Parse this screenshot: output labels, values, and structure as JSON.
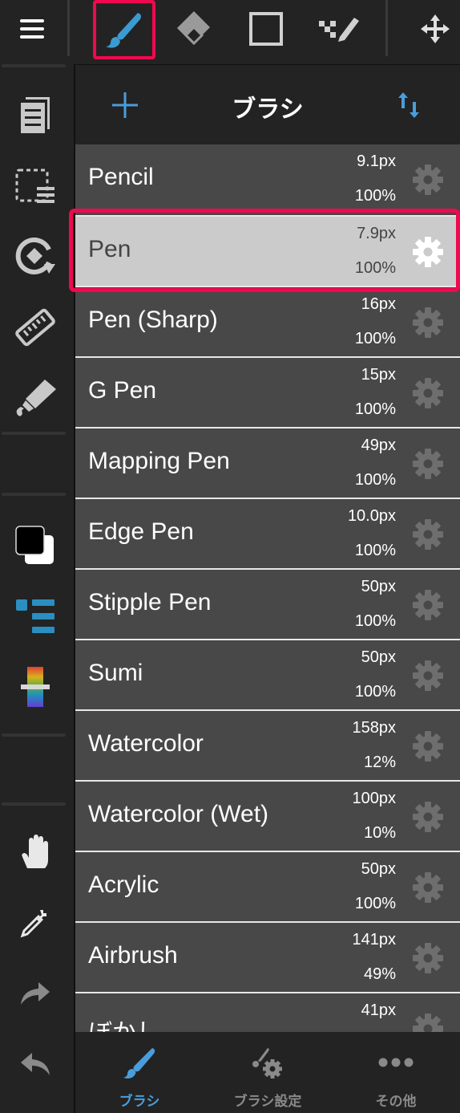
{
  "colors": {
    "accent": "#4a9ddb",
    "highlight": "#f0094f",
    "background": "#232323",
    "row_bg": "#484848",
    "row_selected_bg": "#cbcbcb"
  },
  "toolbar": {
    "menu_icon": "hamburger-menu-icon",
    "tools": [
      {
        "name": "brush",
        "icon": "brush-icon",
        "active": true
      },
      {
        "name": "eraser",
        "icon": "eraser-icon",
        "active": false
      },
      {
        "name": "selection-rect",
        "icon": "square-icon",
        "active": false
      },
      {
        "name": "stipple-pen",
        "icon": "stipple-pen-icon",
        "active": false
      }
    ],
    "move_icon": "move-arrows-icon"
  },
  "sidebar": {
    "items": [
      {
        "name": "layers",
        "icon": "layers-icon"
      },
      {
        "name": "selection",
        "icon": "selection-menu-icon"
      },
      {
        "name": "transform",
        "icon": "rotate-transform-icon"
      },
      {
        "name": "ruler",
        "icon": "ruler-icon"
      },
      {
        "name": "fill",
        "icon": "fill-bucket-icon"
      },
      {
        "name": "color",
        "icon": "color-swatch-icon"
      },
      {
        "name": "palette",
        "icon": "palette-list-icon"
      },
      {
        "name": "color-slider",
        "icon": "rainbow-slider-icon"
      },
      {
        "name": "hand",
        "icon": "hand-icon"
      },
      {
        "name": "eyedropper",
        "icon": "eyedropper-icon"
      },
      {
        "name": "redo",
        "icon": "redo-icon"
      },
      {
        "name": "undo",
        "icon": "undo-icon"
      }
    ]
  },
  "panel": {
    "title": "ブラシ",
    "add_icon": "plus-icon",
    "sort_icon": "sort-arrows-icon",
    "brushes": [
      {
        "name": "Pencil",
        "size": "9.1px",
        "opacity": "100%",
        "selected": false
      },
      {
        "name": "Pen",
        "size": "7.9px",
        "opacity": "100%",
        "selected": true
      },
      {
        "name": "Pen (Sharp)",
        "size": "16px",
        "opacity": "100%",
        "selected": false
      },
      {
        "name": "G Pen",
        "size": "15px",
        "opacity": "100%",
        "selected": false
      },
      {
        "name": "Mapping Pen",
        "size": "49px",
        "opacity": "100%",
        "selected": false
      },
      {
        "name": "Edge Pen",
        "size": "10.0px",
        "opacity": "100%",
        "selected": false
      },
      {
        "name": "Stipple Pen",
        "size": "50px",
        "opacity": "100%",
        "selected": false
      },
      {
        "name": "Sumi",
        "size": "50px",
        "opacity": "100%",
        "selected": false
      },
      {
        "name": "Watercolor",
        "size": "158px",
        "opacity": "12%",
        "selected": false
      },
      {
        "name": "Watercolor (Wet)",
        "size": "100px",
        "opacity": "10%",
        "selected": false
      },
      {
        "name": "Acrylic",
        "size": "50px",
        "opacity": "100%",
        "selected": false
      },
      {
        "name": "Airbrush",
        "size": "141px",
        "opacity": "49%",
        "selected": false
      },
      {
        "name": "ぼかし",
        "size": "41px",
        "opacity": "",
        "selected": false
      }
    ]
  },
  "bottom_tabs": [
    {
      "label": "ブラシ",
      "icon": "brush-icon",
      "active": true
    },
    {
      "label": "ブラシ設定",
      "icon": "brush-settings-icon",
      "active": false
    },
    {
      "label": "その他",
      "icon": "more-dots-icon",
      "active": false
    }
  ]
}
